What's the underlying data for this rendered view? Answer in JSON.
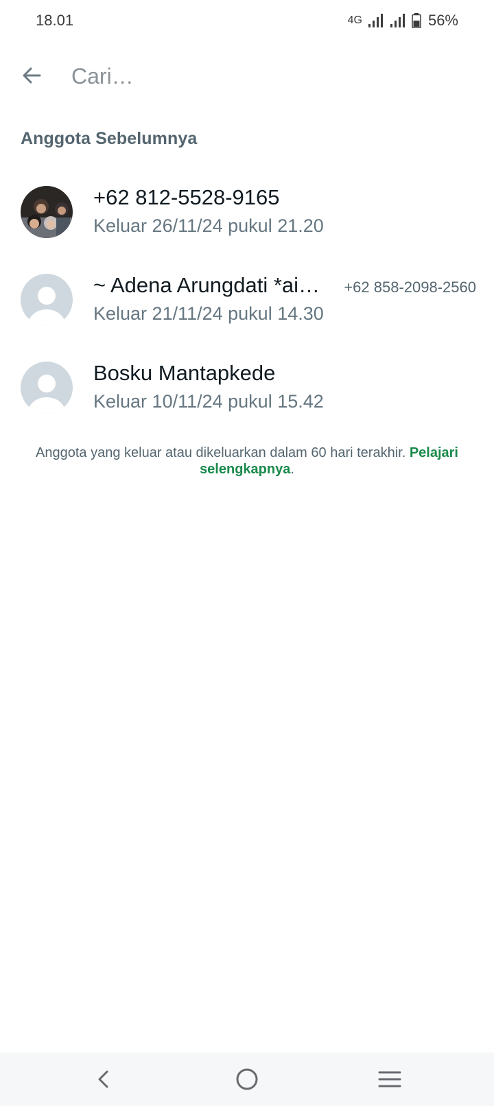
{
  "status_bar": {
    "time": "18.01",
    "network": "4G",
    "battery": "56%",
    "battery_level": 0.56
  },
  "search": {
    "placeholder": "Cari…",
    "value": ""
  },
  "section": {
    "title": "Anggota Sebelumnya"
  },
  "members": [
    {
      "name": "+62 812-5528-9165",
      "phone": "",
      "status": "Keluar 26/11/24 pukul 21.20",
      "avatar": "photo"
    },
    {
      "name": "~ Adena Arungdati *ai…",
      "phone": "+62 858-2098-2560",
      "status": "Keluar 21/11/24 pukul 14.30",
      "avatar": "default-person-icon"
    },
    {
      "name": "Bosku Mantapkede",
      "phone": "",
      "status": "Keluar 10/11/24 pukul 15.42",
      "avatar": "default-person-icon"
    }
  ],
  "footer": {
    "note": "Anggota yang keluar atau dikeluarkan dalam 60 hari terakhir. ",
    "link": "Pelajari selengkapnya",
    "suffix": "."
  },
  "colors": {
    "accent_green": "#1a8a4c",
    "secondary_text": "#667781",
    "avatar_placeholder": "#cfd8de"
  },
  "nav_bar": {
    "back": "back-icon",
    "home": "home-icon",
    "recents": "menu-icon"
  }
}
